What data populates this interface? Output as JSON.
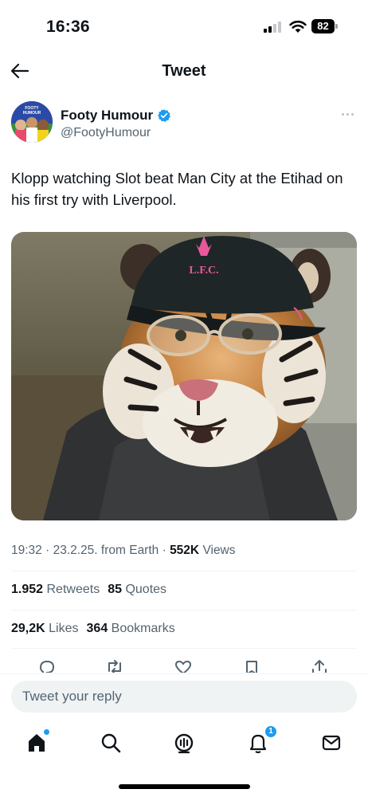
{
  "status_bar": {
    "time": "16:36",
    "battery": "82"
  },
  "nav": {
    "title": "Tweet",
    "back_icon": "arrow-left-icon"
  },
  "author": {
    "name": "Footy Humour",
    "handle": "@FootyHumour",
    "verified": true,
    "avatar_text": "FOOTY HUMOUR"
  },
  "tweet": {
    "text": "Klopp watching Slot beat Man City at the Etihad on his first try with Liverpool.",
    "image_alt": "Tiger wearing a Liverpool cap and glasses",
    "cap_text": "L.F.C."
  },
  "meta": {
    "time": "19:32",
    "date": "23.2.25.",
    "source": "from Earth",
    "views_count": "552K",
    "views_label": "Views"
  },
  "stats": {
    "retweets_count": "1.952",
    "retweets_label": "Retweets",
    "quotes_count": "85",
    "quotes_label": "Quotes",
    "likes_count": "29,2K",
    "likes_label": "Likes",
    "bookmarks_count": "364",
    "bookmarks_label": "Bookmarks"
  },
  "actions": [
    "reply-icon",
    "retweet-icon",
    "like-icon",
    "bookmark-icon",
    "share-icon"
  ],
  "reply": {
    "placeholder": "Tweet your reply"
  },
  "tabbar": {
    "tabs": [
      "home-icon",
      "search-icon",
      "spaces-icon",
      "notifications-icon",
      "messages-icon"
    ],
    "notifications_badge": "1"
  },
  "colors": {
    "accent": "#1d9bf0",
    "text": "#0f1419",
    "secondary": "#536471",
    "divider": "#eff3f4"
  }
}
